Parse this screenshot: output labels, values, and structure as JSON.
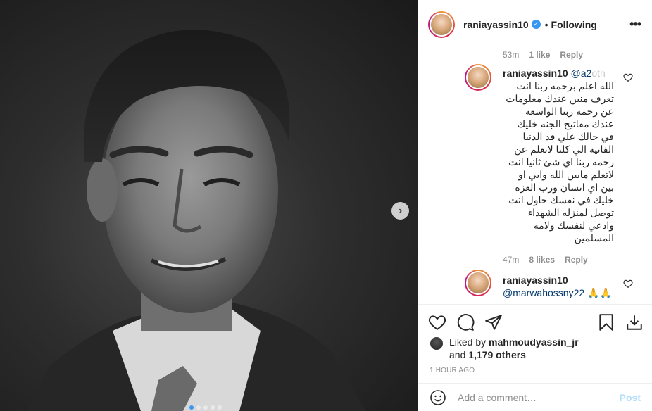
{
  "post": {
    "media": {
      "slide_count": 5,
      "active_slide": 1,
      "next_icon": "chevron-right-icon"
    },
    "author": {
      "username": "rania​yassin10",
      "verified": true,
      "follow_state": "Following",
      "separator": "•",
      "more_icon": "more-horizontal-icon"
    }
  },
  "comments": {
    "prev_reply": {
      "time": "53m",
      "likes": "1 like",
      "reply_label": "Reply"
    },
    "items": [
      {
        "username": "raniayassin10",
        "mention": "@a2",
        "mention_faded": "oth",
        "lines": [
          "الله اعلم برحمه ربنا انت",
          "تعرف منين عندك معلومات",
          "عن رحمه ربنا الواسعه",
          "عندك مفاتيح الجنه خليك",
          "في حالك علي قد الدنيا",
          "الفانيه الي كلنا لانعلم عن",
          "رحمه ربنا اي شئ ثانيا انت",
          "لاتعلم مابين الله وابي او",
          "بين اي انسان ورب العزه",
          "خليك في نفسك حاول انت",
          "توصل لمنزله الشهداء",
          "وادعي لنفسك ولامه",
          "المسلمين"
        ],
        "time": "47m",
        "likes": "8 likes",
        "reply_label": "Reply"
      },
      {
        "username": "raniayassin10",
        "mention": "@marwahossny22",
        "emoji": "🙏🙏"
      }
    ]
  },
  "actions": {
    "icons": [
      "heart-icon",
      "comment-icon",
      "share-icon",
      "save-icon",
      "download-icon"
    ]
  },
  "likes": {
    "prefix": "Liked by ",
    "user": "mahmoudyassin_jr",
    "joiner": " and",
    "others": "1,179 others"
  },
  "timestamp": "1 HOUR AGO",
  "add_comment": {
    "placeholder": "Add a comment…",
    "post_label": "Post",
    "emoji_icon": "smiley-icon"
  },
  "colors": {
    "accent": "#3897f0",
    "post_disabled": "#b2dffc",
    "muted": "#8e8e8e",
    "text": "#262626",
    "mention": "#00376b"
  }
}
